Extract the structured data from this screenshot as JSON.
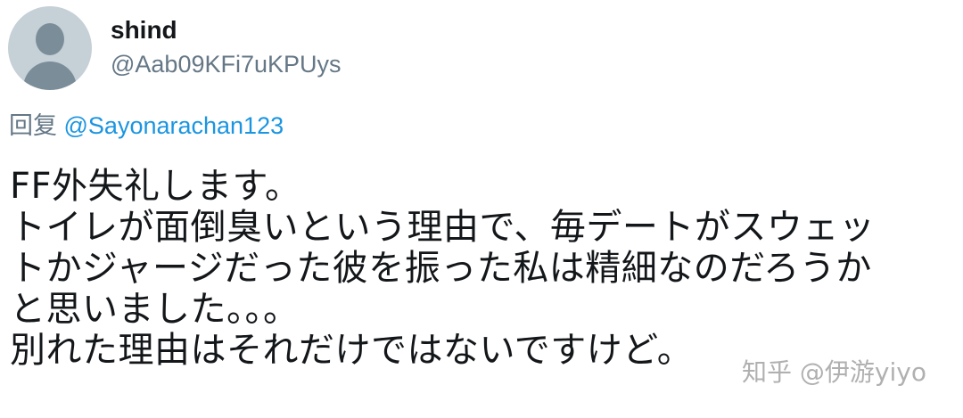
{
  "author": {
    "display_name": "shind",
    "handle": "@Aab09KFi7uKPUys",
    "avatar_icon": "default-avatar-icon"
  },
  "reply": {
    "prefix": "回复",
    "mention": "@Sayonarachan123"
  },
  "tweet": {
    "text": "FF外失礼します。\nトイレが面倒臭いという理由で、毎デートがスウェッ\nトかジャージだった彼を振った私は精細なのだろうか\nと思いました。。。\n別れた理由はそれだけではないですけど。"
  },
  "watermark": {
    "text": "知乎 @伊游yiyo"
  },
  "colors": {
    "text": "#14171a",
    "secondary": "#657786",
    "link": "#1b95e0",
    "avatar_bg": "#c5d0d7",
    "avatar_fg": "#7b8d98"
  }
}
